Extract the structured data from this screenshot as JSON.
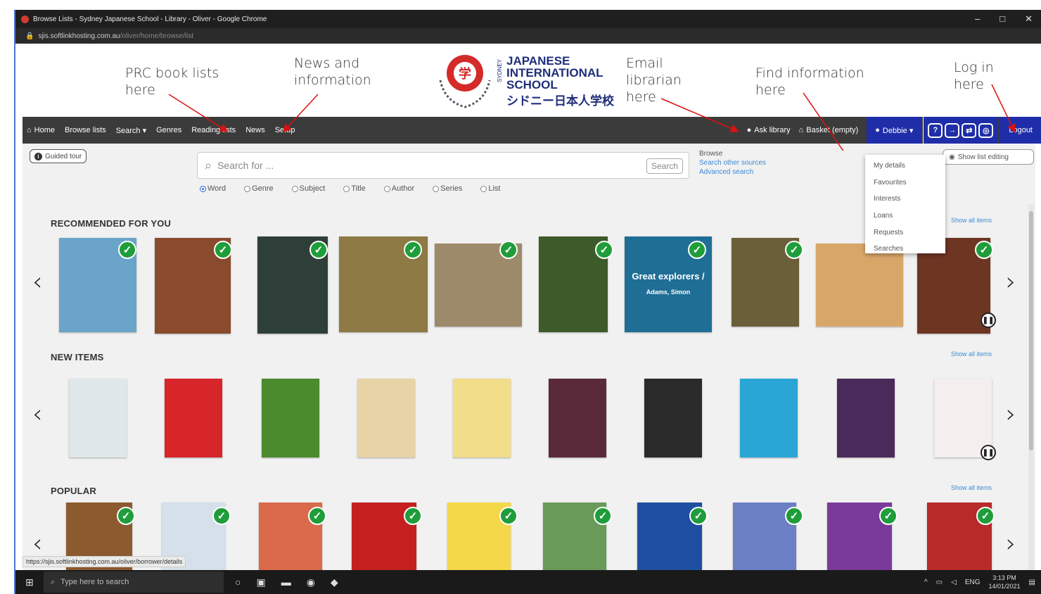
{
  "window": {
    "title": "Browse Lists - Sydney Japanese School - Library - Oliver - Google Chrome",
    "url_host": "sjis.softlinkhosting.com.au",
    "url_path": "/oliver/home/browse/list",
    "controls": [
      "–",
      "□",
      "✕"
    ]
  },
  "annotations": {
    "prc": "PRC book lists here",
    "news": "News and information",
    "email": "Email librarian here",
    "find": "Find information here",
    "login": "Log in here"
  },
  "logo": {
    "sydney": "SYDNEY",
    "line1": "JAPANESE",
    "line2": "INTERNATIONAL",
    "line3": "SCHOOL",
    "jp": "シドニー日本人学校"
  },
  "nav": {
    "home": "Home",
    "browse": "Browse lists",
    "search": "Search ▾",
    "genres": "Genres",
    "reading": "Reading lists",
    "news": "News",
    "setup": "Setup",
    "ask": "Ask library",
    "basket": "Basket (empty)",
    "user": "Debbie ▾",
    "logout": "Logout"
  },
  "search": {
    "guided": "Guided tour",
    "placeholder": "Search for ...",
    "button": "Search",
    "options": [
      "Word",
      "Genre",
      "Subject",
      "Title",
      "Author",
      "Series",
      "List"
    ],
    "selected": "Word",
    "browse_label": "Browse",
    "other_sources": "Search other sources",
    "advanced": "Advanced search",
    "show_list_editing": "Show list editing"
  },
  "user_menu": [
    "My details",
    "Favourites",
    "Interests",
    "Loans",
    "Requests",
    "Searches"
  ],
  "sections": {
    "recommended": "RECOMMENDED FOR YOU",
    "new_items": "NEW ITEMS",
    "popular": "POPULAR",
    "show_all": "Show all items"
  },
  "books": {
    "explorers_title": "Great explorers /",
    "explorers_author": "Adams, Simon"
  },
  "status_url": "https://sjis.softlinkhosting.com.au/oliver/borrower/details",
  "taskbar": {
    "search": "Type here to search",
    "lang": "ENG",
    "time": "3:13 PM",
    "date": "14/01/2021"
  },
  "colors": {
    "nav": "#3b3b3b",
    "user_blue": "#1f2ea8",
    "check_green": "#1f9d3a",
    "link": "#3c8ad6"
  }
}
